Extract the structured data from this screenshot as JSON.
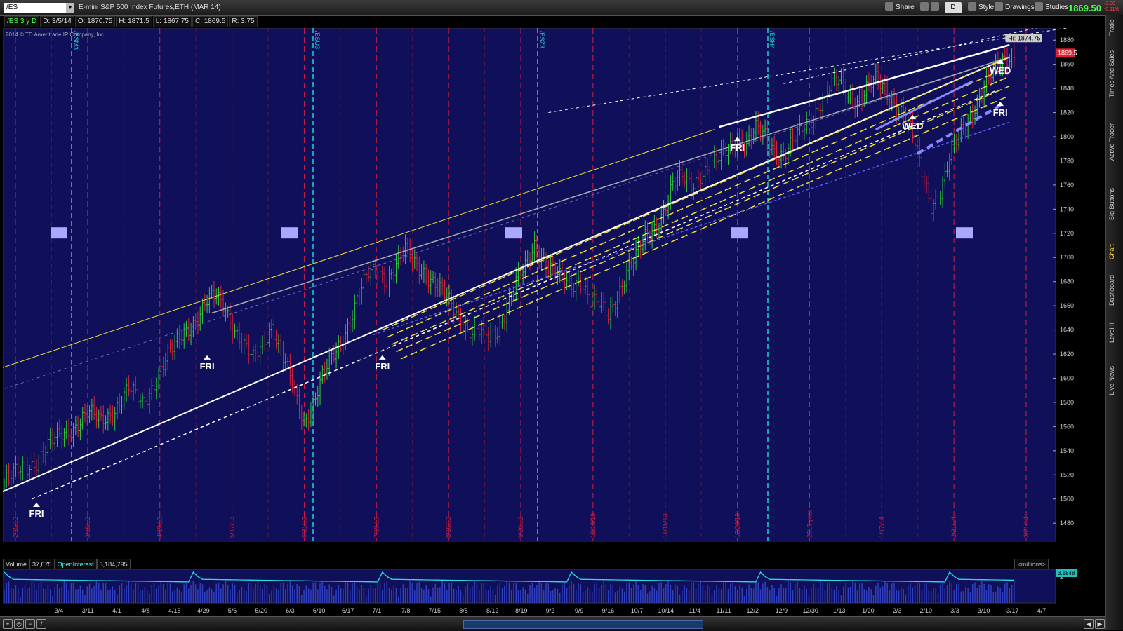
{
  "toolbar": {
    "symbol": "/ES",
    "title": "E-mini S&P 500 Index Futures,ETH (MAR 14)",
    "share": "Share",
    "period": "D",
    "style": "Style",
    "drawings": "Drawings",
    "studies": "Studies",
    "last_price": "1869.50",
    "change": "-2.00",
    "change_pct": "-0.11%"
  },
  "info": {
    "sym": "/ES 3 y D",
    "date": "D: 3/5/14",
    "open": "O: 1870.75",
    "high": "H: 1871.5",
    "low": "L: 1867.75",
    "close": "C: 1869.5",
    "range": "R: 3.75"
  },
  "copyright": "2014 © TD Ameritrade IP Company, Inc.",
  "side_tabs": [
    "Trade",
    "Times And Sales",
    "Active Trader",
    "Big Buttons",
    "Chart",
    "Dashboard",
    "Level II",
    "Live News"
  ],
  "colors": {
    "bg": "#000000",
    "plot_bg": "#10105a",
    "up": "#2ecc40",
    "down": "#e0203a",
    "yellow": "#f0e030",
    "cyan_line": "#20d0d0",
    "red_line": "#d02040",
    "white_line": "#ffffff",
    "blue_line": "#6666ee",
    "volume": "#3040c0"
  },
  "volume_panel": {
    "volume_label": "Volume",
    "volume_value": "37,675",
    "oi_label": "OpenInterest",
    "oi_value": "3,184,795",
    "units": "<millions>",
    "oi_readout": "3.1848",
    "ticks": [
      "2"
    ]
  },
  "chart_data": {
    "type": "candlestick",
    "price_axis": {
      "ylim": [
        1465,
        1890
      ],
      "ticks": [
        1480,
        1500,
        1520,
        1540,
        1560,
        1580,
        1600,
        1620,
        1640,
        1660,
        1680,
        1700,
        1720,
        1740,
        1760,
        1780,
        1800,
        1820,
        1840,
        1860,
        1880
      ],
      "high_label": "Hi: 1874.75",
      "last_label": "1869.5"
    },
    "x_axis": {
      "ticks": [
        "3/4",
        "3/11",
        "4/1",
        "4/8",
        "4/15",
        "4/29",
        "5/6",
        "5/20",
        "6/3",
        "6/10",
        "6/17",
        "7/1",
        "7/8",
        "7/15",
        "8/5",
        "8/12",
        "8/19",
        "9/2",
        "9/9",
        "9/16",
        "10/7",
        "10/14",
        "11/4",
        "11/11",
        "12/2",
        "12/9",
        "12/30",
        "1/13",
        "1/20",
        "2/3",
        "2/10",
        "3/3",
        "3/10",
        "3/17",
        "4/7"
      ]
    },
    "expiration_labels": [
      "/ESM3",
      "/ESU3",
      "/ESZ3",
      "/ESH4"
    ],
    "vertical_date_labels": [
      "2/15/13",
      "3/15/13",
      "4/19/13",
      "5/17/13",
      "6/21/13",
      "7/19/13",
      "8/16/13",
      "9/20/13",
      "10/18/13",
      "11/15/13",
      "12/20/13",
      "2013 year",
      "1/17/14",
      "2/21/14",
      "3/21/14"
    ],
    "annotations": [
      "FRI",
      "FRI",
      "FRI",
      "FRI",
      "WED",
      "WED",
      "FRI"
    ],
    "price_path": [
      [
        0,
        1514
      ],
      [
        8,
        1525
      ],
      [
        14,
        1532
      ],
      [
        20,
        1545
      ],
      [
        26,
        1555
      ],
      [
        30,
        1560
      ],
      [
        36,
        1570
      ],
      [
        42,
        1565
      ],
      [
        48,
        1575
      ],
      [
        54,
        1590
      ],
      [
        60,
        1580
      ],
      [
        66,
        1600
      ],
      [
        72,
        1620
      ],
      [
        78,
        1640
      ],
      [
        84,
        1650
      ],
      [
        88,
        1662
      ],
      [
        92,
        1668
      ],
      [
        96,
        1660
      ],
      [
        100,
        1640
      ],
      [
        104,
        1625
      ],
      [
        108,
        1615
      ],
      [
        112,
        1630
      ],
      [
        116,
        1645
      ],
      [
        120,
        1620
      ],
      [
        124,
        1600
      ],
      [
        128,
        1575
      ],
      [
        130,
        1565
      ],
      [
        134,
        1580
      ],
      [
        138,
        1600
      ],
      [
        142,
        1615
      ],
      [
        146,
        1630
      ],
      [
        150,
        1650
      ],
      [
        154,
        1670
      ],
      [
        158,
        1685
      ],
      [
        162,
        1690
      ],
      [
        166,
        1682
      ],
      [
        170,
        1695
      ],
      [
        174,
        1705
      ],
      [
        178,
        1695
      ],
      [
        182,
        1690
      ],
      [
        186,
        1680
      ],
      [
        190,
        1670
      ],
      [
        194,
        1660
      ],
      [
        198,
        1650
      ],
      [
        202,
        1640
      ],
      [
        206,
        1638
      ],
      [
        210,
        1632
      ],
      [
        214,
        1640
      ],
      [
        218,
        1660
      ],
      [
        222,
        1680
      ],
      [
        226,
        1690
      ],
      [
        230,
        1710
      ],
      [
        234,
        1700
      ],
      [
        238,
        1690
      ],
      [
        242,
        1680
      ],
      [
        246,
        1675
      ],
      [
        250,
        1685
      ],
      [
        254,
        1665
      ],
      [
        258,
        1660
      ],
      [
        262,
        1650
      ],
      [
        266,
        1670
      ],
      [
        270,
        1690
      ],
      [
        274,
        1700
      ],
      [
        278,
        1715
      ],
      [
        282,
        1725
      ],
      [
        286,
        1740
      ],
      [
        290,
        1760
      ],
      [
        294,
        1765
      ],
      [
        298,
        1760
      ],
      [
        302,
        1770
      ],
      [
        306,
        1775
      ],
      [
        310,
        1780
      ],
      [
        314,
        1790
      ],
      [
        318,
        1800
      ],
      [
        322,
        1795
      ],
      [
        326,
        1805
      ],
      [
        330,
        1800
      ],
      [
        334,
        1790
      ],
      [
        338,
        1785
      ],
      [
        342,
        1795
      ],
      [
        346,
        1805
      ],
      [
        350,
        1815
      ],
      [
        354,
        1830
      ],
      [
        358,
        1840
      ],
      [
        362,
        1845
      ],
      [
        366,
        1835
      ],
      [
        370,
        1830
      ],
      [
        374,
        1840
      ],
      [
        378,
        1845
      ],
      [
        382,
        1838
      ],
      [
        386,
        1830
      ],
      [
        390,
        1820
      ],
      [
        394,
        1800
      ],
      [
        398,
        1770
      ],
      [
        402,
        1745
      ],
      [
        406,
        1755
      ],
      [
        410,
        1780
      ],
      [
        414,
        1800
      ],
      [
        418,
        1815
      ],
      [
        422,
        1830
      ],
      [
        426,
        1845
      ],
      [
        430,
        1855
      ],
      [
        434,
        1865
      ],
      [
        438,
        1869.5
      ]
    ],
    "n_bars": 440
  }
}
